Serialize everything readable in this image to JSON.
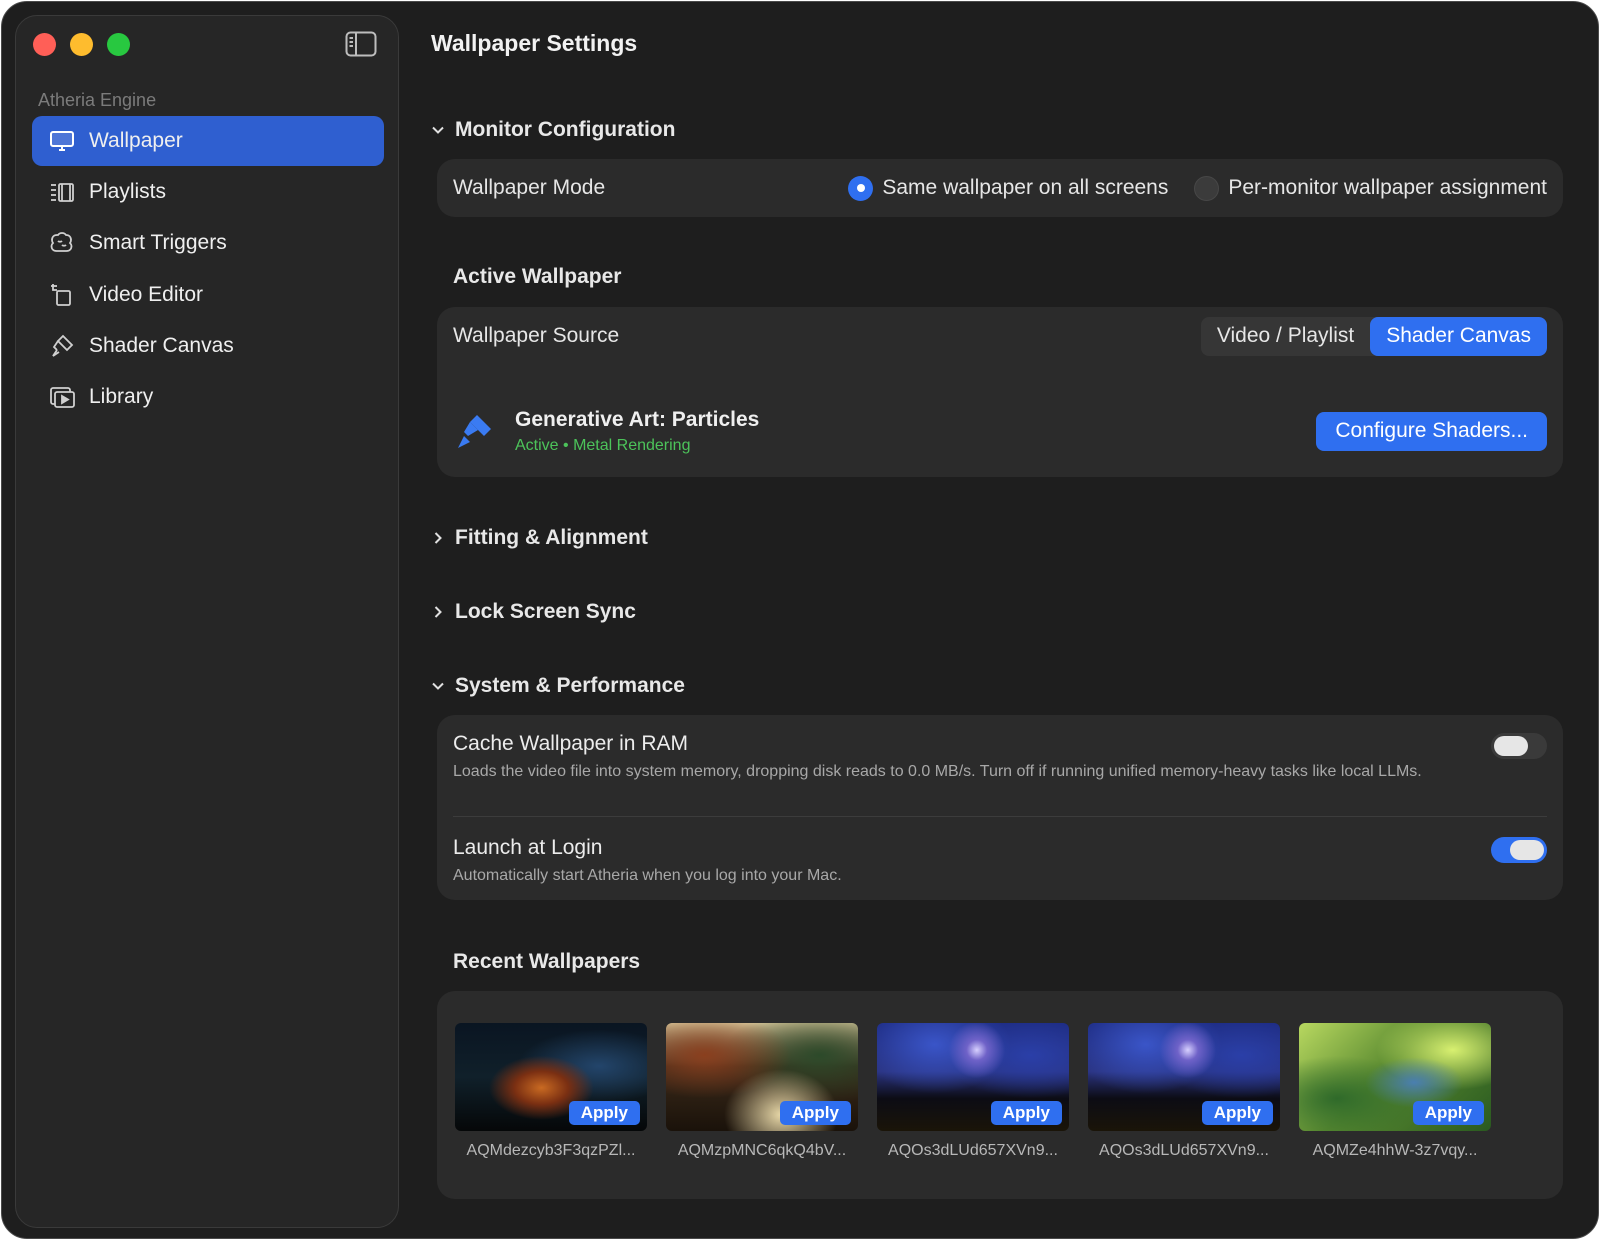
{
  "window": {
    "title": "Wallpaper Settings"
  },
  "sidebar": {
    "section_label": "Atheria Engine",
    "items": [
      {
        "label": "Wallpaper",
        "icon": "monitor-icon",
        "active": true
      },
      {
        "label": "Playlists",
        "icon": "playlist-icon",
        "active": false
      },
      {
        "label": "Smart Triggers",
        "icon": "brain-icon",
        "active": false
      },
      {
        "label": "Video Editor",
        "icon": "crop-icon",
        "active": false
      },
      {
        "label": "Shader Canvas",
        "icon": "paintbrush-icon",
        "active": false
      },
      {
        "label": "Library",
        "icon": "media-library-icon",
        "active": false
      }
    ]
  },
  "monitor_config": {
    "header": "Monitor Configuration",
    "expanded": true,
    "mode_label": "Wallpaper Mode",
    "options": [
      {
        "label": "Same wallpaper on all screens",
        "selected": true
      },
      {
        "label": "Per-monitor wallpaper assignment",
        "selected": false
      }
    ]
  },
  "active_wallpaper": {
    "header": "Active Wallpaper",
    "source_label": "Wallpaper Source",
    "source_options": [
      "Video / Playlist",
      "Shader Canvas"
    ],
    "source_selected": "Shader Canvas",
    "shader_name": "Generative Art: Particles",
    "shader_status": "Active • Metal Rendering",
    "configure_label": "Configure Shaders..."
  },
  "collapsed_sections": [
    {
      "header": "Fitting & Alignment",
      "expanded": false
    },
    {
      "header": "Lock Screen Sync",
      "expanded": false
    }
  ],
  "system_performance": {
    "header": "System & Performance",
    "expanded": true,
    "settings": [
      {
        "title": "Cache Wallpaper in RAM",
        "description": "Loads the video file into system memory, dropping disk reads to 0.0 MB/s. Turn off if running unified memory-heavy tasks like local LLMs.",
        "enabled": false
      },
      {
        "title": "Launch at Login",
        "description": "Automatically start Atheria when you log into your Mac.",
        "enabled": true
      }
    ]
  },
  "recent_wallpapers": {
    "header": "Recent Wallpapers",
    "apply_label": "Apply",
    "items": [
      {
        "name": "AQMdezcyb3F3qzPZl..."
      },
      {
        "name": "AQMzpMNC6qkQ4bV..."
      },
      {
        "name": "AQOs3dLUd657XVn9..."
      },
      {
        "name": "AQOs3dLUd657XVn9..."
      },
      {
        "name": "AQMZe4hhW-3z7vqy..."
      }
    ]
  },
  "colors": {
    "accent": "#2f6ff0",
    "sidebar_selection": "#2f5fd0",
    "status_green": "#4cc35a",
    "window_bg": "#1e1e1e",
    "card_bg": "#2b2b2b"
  }
}
